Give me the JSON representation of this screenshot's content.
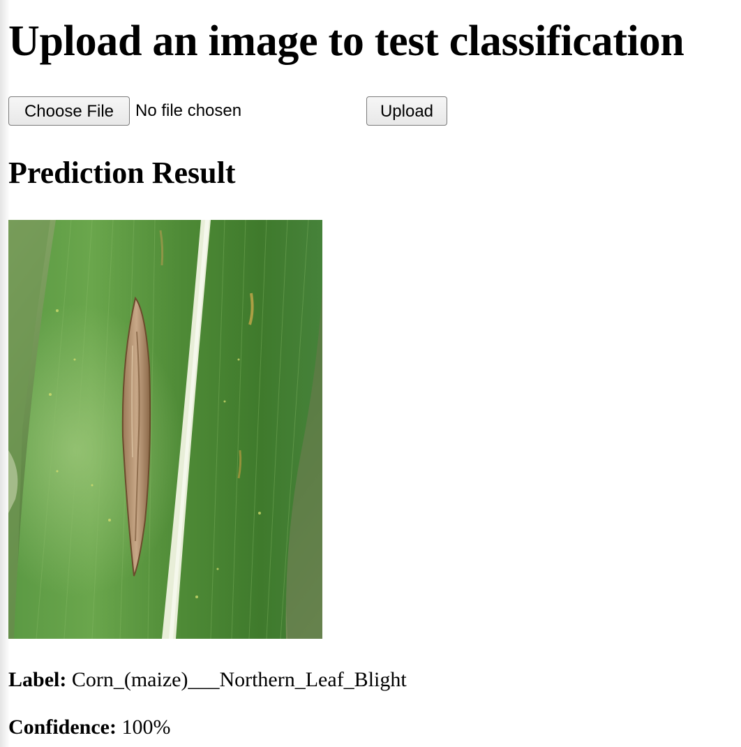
{
  "page": {
    "title": "Upload an image to test classification"
  },
  "form": {
    "choose_file_label": "Choose File",
    "file_status": "No file chosen",
    "upload_label": "Upload"
  },
  "result": {
    "heading": "Prediction Result",
    "image_description": "corn-leaf-photo",
    "label_key": "Label:",
    "label_value": "Corn_(maize)___Northern_Leaf_Blight",
    "confidence_key": "Confidence:",
    "confidence_value": "100%"
  }
}
